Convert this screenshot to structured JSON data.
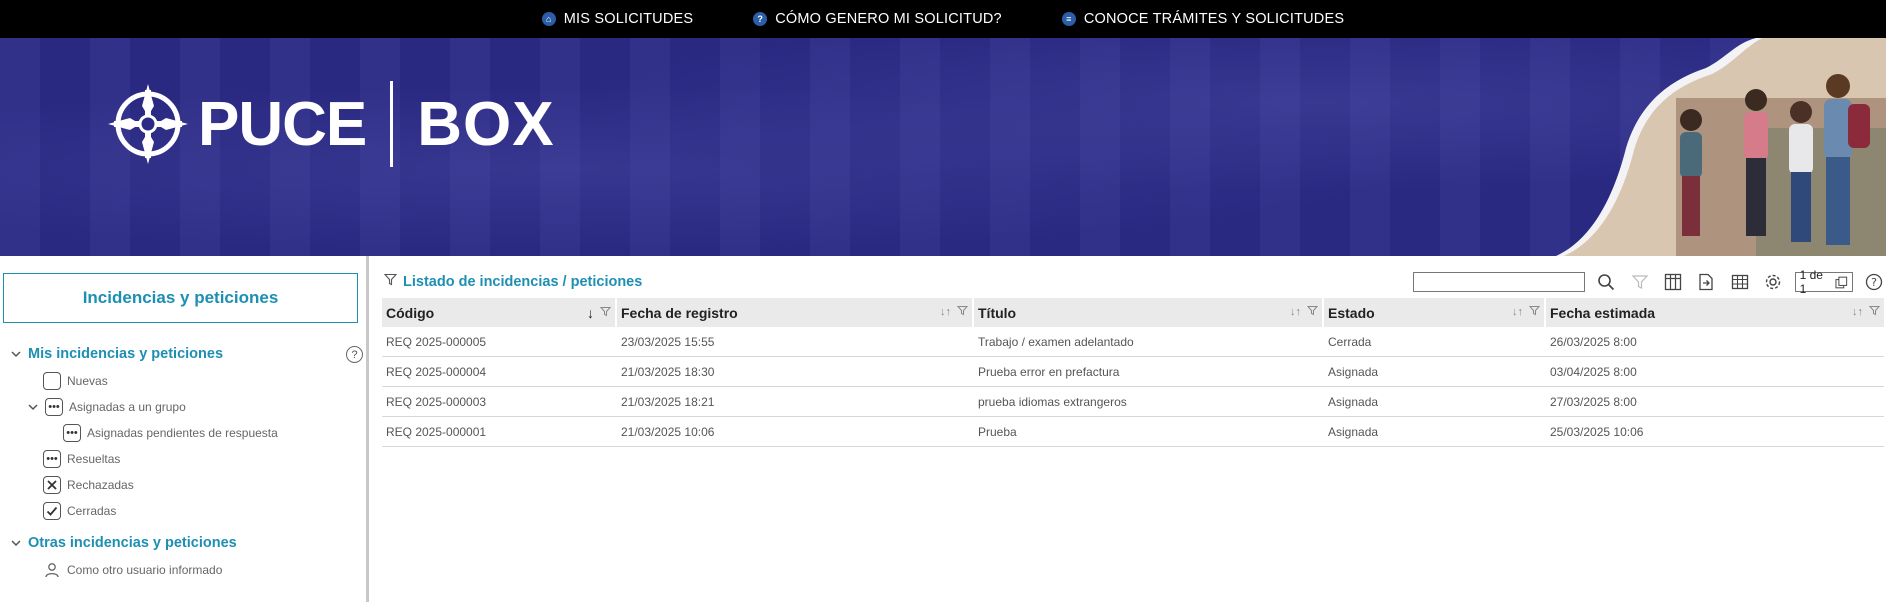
{
  "topnav": {
    "items": [
      {
        "label": "MIS SOLICITUDES",
        "icon": "home-icon"
      },
      {
        "label": "CÓMO GENERO MI SOLICITUD?",
        "icon": "question-icon"
      },
      {
        "label": "CONOCE TRÁMITES Y SOLICITUDES",
        "icon": "document-icon"
      }
    ]
  },
  "banner": {
    "brand": "PUCE",
    "product": "BOX"
  },
  "sidebar": {
    "title": "Incidencias y peticiones",
    "groups": [
      {
        "label": "Mis incidencias y peticiones",
        "items": [
          {
            "label": "Nuevas",
            "icon": "empty-square-icon"
          },
          {
            "label": "Asignadas a un grupo",
            "icon": "dots-square-icon"
          },
          {
            "label": "Asignadas pendientes de respuesta",
            "icon": "dots-square-icon"
          },
          {
            "label": "Resueltas",
            "icon": "dots-square-icon"
          },
          {
            "label": "Rechazadas",
            "icon": "x-square-icon"
          },
          {
            "label": "Cerradas",
            "icon": "check-square-icon"
          }
        ]
      },
      {
        "label": "Otras incidencias y peticiones",
        "items": [
          {
            "label": "Como otro usuario informado",
            "icon": "user-icon"
          }
        ]
      }
    ]
  },
  "main": {
    "list_title": "Listado de incidencias / peticiones",
    "search": {
      "value": "",
      "placeholder": ""
    },
    "pagination": "1 de 1",
    "columns": [
      "Código",
      "Fecha de registro",
      "Título",
      "Estado",
      "Fecha estimada"
    ],
    "rows": [
      [
        "REQ 2025-000005",
        "23/03/2025 15:55",
        "Trabajo / examen adelantado",
        "Cerrada",
        "26/03/2025 8:00"
      ],
      [
        "REQ 2025-000004",
        "21/03/2025 18:30",
        "Prueba error en prefactura",
        "Asignada",
        "03/04/2025 8:00"
      ],
      [
        "REQ 2025-000003",
        "21/03/2025 18:21",
        "prueba idiomas extrangeros",
        "Asignada",
        "27/03/2025 8:00"
      ],
      [
        "REQ 2025-000001",
        "21/03/2025 10:06",
        "Prueba",
        "Asignada",
        "25/03/2025 10:06"
      ]
    ]
  },
  "colors": {
    "topbar": "#000000",
    "banner": "#2b2a86",
    "accent": "#1d8fb3"
  }
}
